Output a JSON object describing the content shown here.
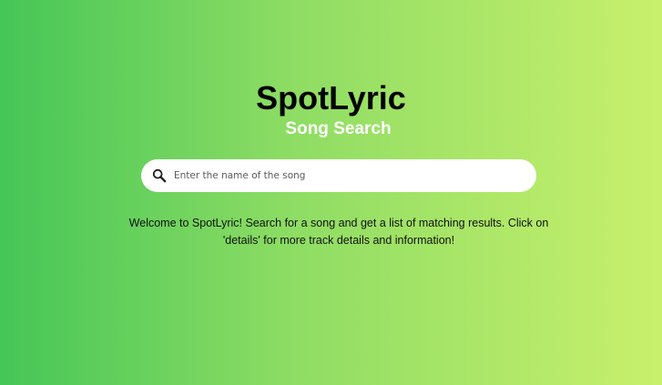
{
  "app": {
    "title": "SpotLyric",
    "subtitle": "Song Search"
  },
  "search": {
    "icon": "search-icon",
    "placeholder": "Enter the name of the song",
    "value": ""
  },
  "welcome": {
    "text": "Welcome to SpotLyric! Search for a song and get a list of matching results. Click on 'details' for more track details and information!"
  },
  "colors": {
    "gradient_start": "#45c657",
    "gradient_end": "#c8f06c",
    "title_text": "#000000",
    "subtitle_text": "#ffffff",
    "search_background": "#ffffff"
  }
}
